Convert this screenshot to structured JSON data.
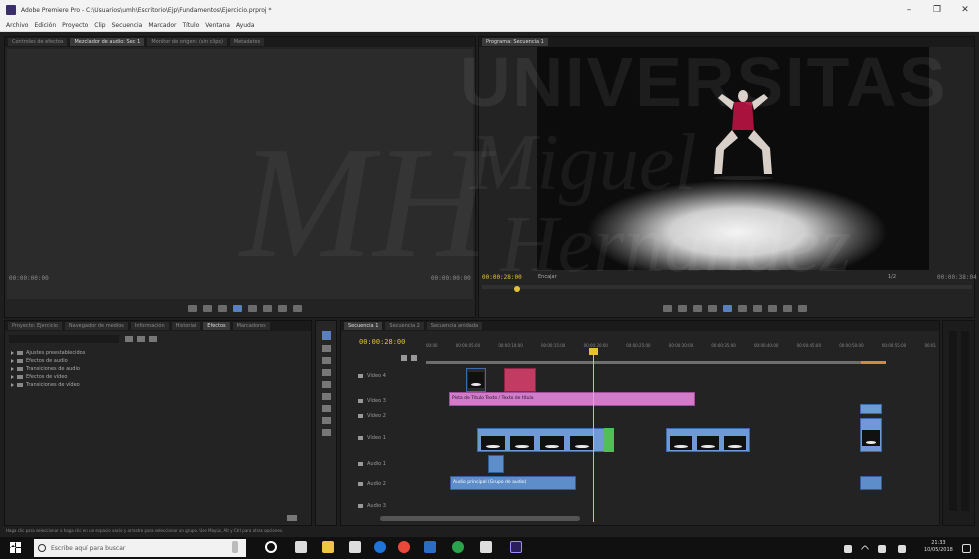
{
  "window": {
    "title": "Adobe Premiere Pro - C:\\Usuarios\\umh\\Escritorio\\Ejp\\Fundamentos\\Ejercicio.prproj *",
    "controls": [
      "–",
      "❐",
      "✕"
    ]
  },
  "menu": [
    "Archivo",
    "Edición",
    "Proyecto",
    "Clip",
    "Secuencia",
    "Marcador",
    "Título",
    "Ventana",
    "Ayuda"
  ],
  "source_monitor": {
    "tabs": [
      "Controles de efectos",
      "Mezclador de audio: Sec 1",
      "Monitor de origen: (sin clips)",
      "Metadatos"
    ],
    "timecode_left": "00:00:00:00",
    "timecode_right": "00:00:00:00"
  },
  "program_monitor": {
    "tab": "Programa: Secuencia 1",
    "timecode_left": "00:00:28:00",
    "fit_label": "Encajar",
    "zoom_label": "1/2",
    "timecode_right": "00:00:38:04"
  },
  "project_panel": {
    "tabs": [
      "Proyecto: Ejercicio",
      "Navegador de medios",
      "Información",
      "Historial",
      "Efectos",
      "Marcadores"
    ],
    "bins": [
      "Ajustes preestablecidos",
      "Efectos de audio",
      "Transiciones de audio",
      "Efectos de vídeo",
      "Transiciones de vídeo"
    ]
  },
  "timeline": {
    "tabs": [
      "Secuencia 1",
      "Secuencia 2",
      "Secuencia anidada"
    ],
    "timecode": "00:00:28:00",
    "ruler": [
      "00:00",
      "00:00:05:00",
      "00:00:10:00",
      "00:00:15:00",
      "00:00:20:00",
      "00:00:25:00",
      "00:00:30:00",
      "00:00:35:00",
      "00:00:40:00",
      "00:00:45:00",
      "00:00:50:00",
      "00:00:55:00",
      "00:01"
    ],
    "tracks": [
      {
        "id": "V4",
        "label": "Vídeo 4"
      },
      {
        "id": "V3",
        "label": "Vídeo 3"
      },
      {
        "id": "V2",
        "label": "Vídeo 2"
      },
      {
        "id": "V1",
        "label": "Vídeo 1"
      },
      {
        "id": "A1",
        "label": "Audio 1"
      },
      {
        "id": "A2",
        "label": "Audio 2"
      },
      {
        "id": "A3",
        "label": "Audio 3"
      }
    ],
    "pink_clip_label": "Pista de Título Texto / Texto de título",
    "audio_clip_label": "Audio principal (Grupo de audio)"
  },
  "status_bar": "Haga clic para seleccionar o haga clic en un espacio vacío y arrastre para seleccionar un grupo. Use Mayús, Alt y Ctrl para otras opciones.",
  "taskbar": {
    "search_placeholder": "Escribe aquí para buscar",
    "time": "21:33",
    "date": "10/05/2018"
  },
  "watermark": {
    "line1": "UNIVERSITAS",
    "line2": "Miguel",
    "line3": "Hernández",
    "monogram": "MH"
  },
  "colors": {
    "playhead": "#e5c13a",
    "video_clip": "#6f9ad6",
    "title_clip": "#d07cc8",
    "taskbar_accent": "#1f74d8"
  }
}
